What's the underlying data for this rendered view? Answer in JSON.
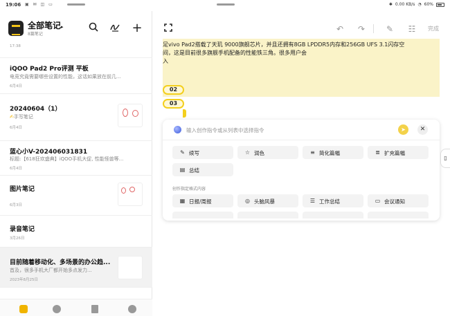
{
  "status_bar": {
    "time": "19:06",
    "left_icons": "▣ ✉ ◫ ▭",
    "speed_value": "0.00",
    "speed_unit": "KB/s",
    "battery": "60%"
  },
  "sidebar": {
    "title": "全部笔记",
    "title_arrow": "▸",
    "count": "8篇笔记",
    "icons": {
      "search": "search-icon",
      "sign": "signature-icon",
      "add": "plus-icon"
    }
  },
  "notes": [
    {
      "title": "",
      "snippet": "",
      "date": "17:38"
    },
    {
      "title": "iQOO Pad2 Pro评测 平板",
      "snippet": "电竞究竟需要哪些设置的性能，这话如果放在前几...",
      "date": "6月4日"
    },
    {
      "title": "20240604（1）",
      "snippet": "手写笔记",
      "snippet_icon": "✍",
      "date": "6月4日"
    },
    {
      "title": "蓝心小V-202406031831",
      "snippet": "标题:【618狂欢盛典】iQOO手机大促, 性能怪兽等...",
      "date": "6月4日"
    },
    {
      "title": "图片笔记",
      "snippet": "",
      "date": "6月3日"
    },
    {
      "title": "录音笔记",
      "snippet": "",
      "date": "3月26日"
    },
    {
      "title": "目前随着移动化、多场景的办公趋...",
      "snippet": "首及，很多手机大厂都开始多点发力...",
      "date": "2023年8月25日"
    }
  ],
  "bottom_nav": [
    {
      "label": "笔记",
      "icon": "note-icon"
    },
    {
      "label": "待办",
      "icon": "todo-icon"
    },
    {
      "label": "文档",
      "icon": "document-icon"
    },
    {
      "label": "我的",
      "icon": "profile-icon"
    }
  ],
  "editor": {
    "toolbar": {
      "expand": "expand-icon",
      "undo": "undo-icon",
      "redo": "redo-icon",
      "pen": "pen-icon",
      "settings": "settings-icon",
      "done": "完成"
    },
    "highlight_lines": [
      "足vivo Pad2搭载了天玑 9000旗舰芯片，并且还拥有8GB LPDDR5内存和256GB UFS 3.1闪存空",
      "间，这是目前很多旗舰手机配备的性能铁三角。很多用户会",
      "入"
    ],
    "pills": [
      "02",
      "03"
    ]
  },
  "ai_panel": {
    "placeholder": "输入创作指令或从列表中选择指令",
    "send_icon": "send-icon",
    "close_icon": "close-icon",
    "commands_row1": [
      {
        "label": "续写",
        "icon": "continue-writing-icon"
      },
      {
        "label": "润色",
        "icon": "polish-icon"
      },
      {
        "label": "简化篇幅",
        "icon": "shorten-icon"
      },
      {
        "label": "扩充篇幅",
        "icon": "expand-text-icon"
      }
    ],
    "commands_row2": [
      {
        "label": "总结",
        "icon": "summary-icon"
      }
    ],
    "section_label": "创作指定格式内容",
    "commands_row3": [
      {
        "label": "日报/周报",
        "icon": "report-icon"
      },
      {
        "label": "头脑风暴",
        "icon": "brainstorm-icon"
      },
      {
        "label": "工作总结",
        "icon": "work-summary-icon"
      },
      {
        "label": "会议通知",
        "icon": "meeting-icon"
      }
    ]
  },
  "colors": {
    "accent": "#f3cf1d",
    "highlight_bg": "#faf3c8",
    "nav_active": "#f0b400"
  }
}
